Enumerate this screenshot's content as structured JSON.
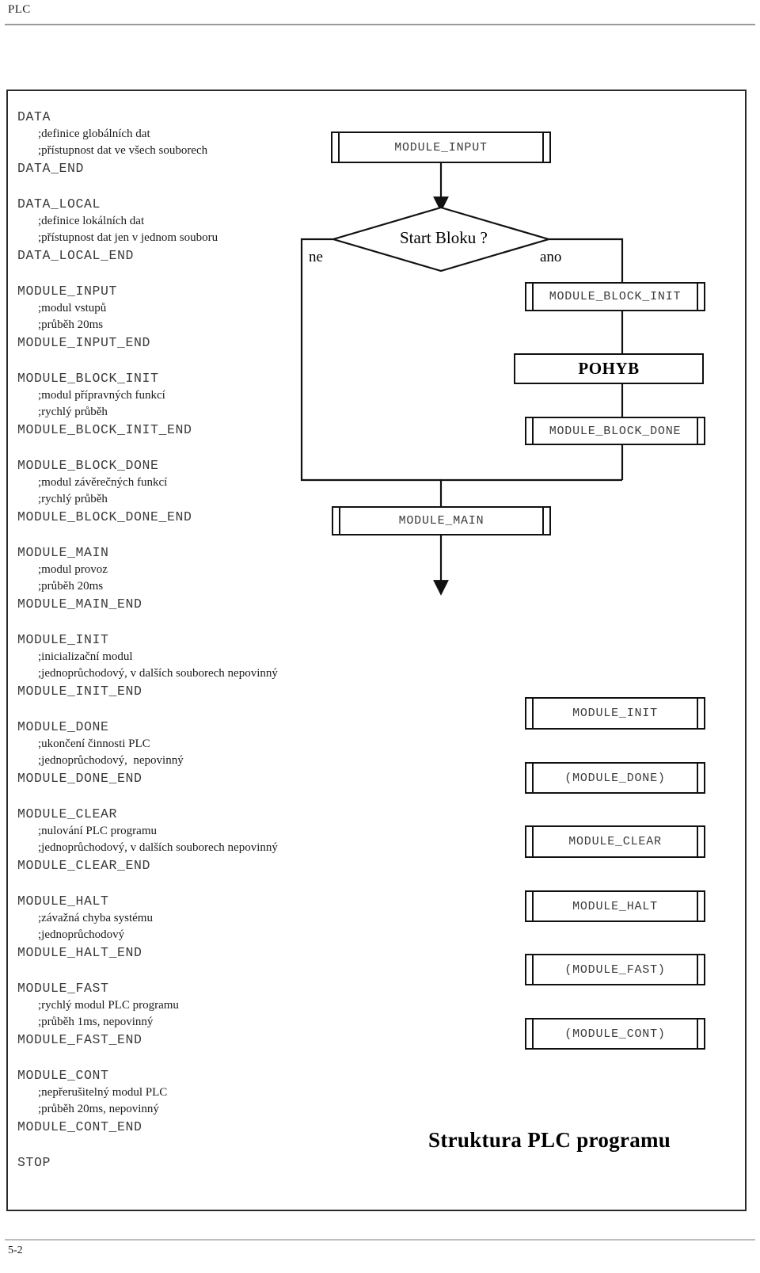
{
  "header": {
    "title": "PLC"
  },
  "footer": {
    "page_number": "5-2"
  },
  "code_blocks": [
    {
      "start": "DATA",
      "comments": [
        ";definice globálních dat",
        ";přístupnost dat ve všech souborech"
      ],
      "end": "DATA_END"
    },
    {
      "start": "DATA_LOCAL",
      "comments": [
        ";definice lokálních dat",
        ";přístupnost dat jen v jednom souboru"
      ],
      "end": "DATA_LOCAL_END"
    },
    {
      "start": "MODULE_INPUT",
      "comments": [
        ";modul vstupů",
        ";průběh 20ms"
      ],
      "end": "MODULE_INPUT_END"
    },
    {
      "start": "MODULE_BLOCK_INIT",
      "comments": [
        ";modul přípravných funkcí",
        ";rychlý průběh"
      ],
      "end": "MODULE_BLOCK_INIT_END"
    },
    {
      "start": "MODULE_BLOCK_DONE",
      "comments": [
        ";modul závěrečných funkcí",
        ";rychlý průběh"
      ],
      "end": "MODULE_BLOCK_DONE_END"
    },
    {
      "start": "MODULE_MAIN",
      "comments": [
        ";modul provoz",
        ";průběh 20ms"
      ],
      "end": "MODULE_MAIN_END"
    },
    {
      "start": "MODULE_INIT",
      "comments": [
        ";inicializační modul",
        ";jednoprůchodový, v dalších souborech nepovinný"
      ],
      "end": "MODULE_INIT_END"
    },
    {
      "start": "MODULE_DONE",
      "comments": [
        ";ukončení činnosti PLC",
        ";jednoprůchodový,  nepovinný"
      ],
      "end": "MODULE_DONE_END"
    },
    {
      "start": "MODULE_CLEAR",
      "comments": [
        ";nulování PLC programu",
        ";jednoprůchodový, v dalších souborech nepovinný"
      ],
      "end": "MODULE_CLEAR_END"
    },
    {
      "start": "MODULE_HALT",
      "comments": [
        ";závažná chyba systému",
        ";jednoprůchodový"
      ],
      "end": "MODULE_HALT_END"
    },
    {
      "start": "MODULE_FAST",
      "comments": [
        ";rychlý modul PLC programu",
        ";průběh 1ms, nepovinný"
      ],
      "end": "MODULE_FAST_END"
    },
    {
      "start": "MODULE_CONT",
      "comments": [
        ";nepřerušitelný modul PLC",
        ";průběh 20ms, nepovinný"
      ],
      "end": "MODULE_CONT_END"
    },
    {
      "start": "STOP",
      "comments": [],
      "end": ""
    }
  ],
  "flowchart": {
    "nodes": {
      "module_input": "MODULE_INPUT",
      "decision": "Start Bloku ?",
      "branch_no": "ne",
      "branch_yes": "ano",
      "module_block_init": "MODULE_BLOCK_INIT",
      "pohyb": "POHYB",
      "module_block_done": "MODULE_BLOCK_DONE",
      "module_main": "MODULE_MAIN",
      "module_init": "MODULE_INIT",
      "module_done": "(MODULE_DONE)",
      "module_clear": "MODULE_CLEAR",
      "module_halt": "MODULE_HALT",
      "module_fast": "(MODULE_FAST)",
      "module_cont": "(MODULE_CONT)"
    },
    "caption": "Struktura PLC programu"
  }
}
